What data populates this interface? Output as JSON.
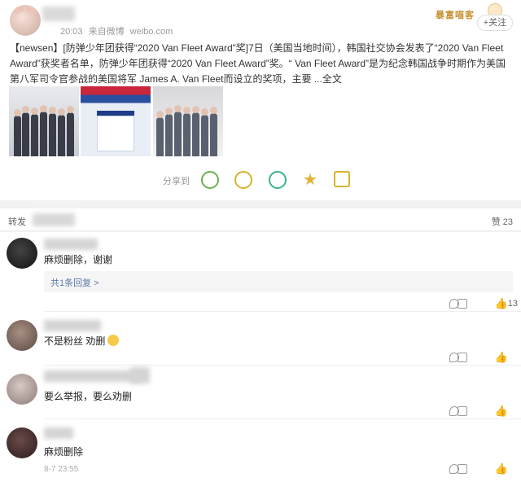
{
  "post": {
    "time": "20:03",
    "source": "来自微博",
    "site": "weibo.com",
    "brand_badge": "暴富喵客",
    "follow_label": "+关注",
    "text": "【newsen】[防弹少年团获得“2020 Van Fleet Award”奖]7日（美国当地时间），韩国社交协会发表了“2020 Van Fleet Award”获奖者名单，防弹少年团获得“2020 Van Fleet Award”奖。“ Van Fleet Award”是为纪念韩国战争时期作为美国第八军司令官参战的美国将军 James A. Van Fleet而设立的奖项，主要 ...全文",
    "share_label": "分享到",
    "images": [
      "group-photo-1",
      "award-announcement",
      "group-photo-2"
    ]
  },
  "forward_bar": {
    "forward_label": "转发",
    "like_label": "赞 23"
  },
  "comments": [
    {
      "text": "麻烦删除，谢谢",
      "replies": "共1条回复 >",
      "time": "",
      "likes": "13"
    },
    {
      "text": "不是粉丝 劝删",
      "replies": "",
      "time": "",
      "likes": ""
    },
    {
      "text": "要么举报，要么劝删",
      "replies": "",
      "time": "",
      "likes": ""
    },
    {
      "text": "麻烦删除",
      "replies": "",
      "time": "8-7 23:55",
      "likes": ""
    }
  ],
  "colors": {
    "link": "#5b7aa8",
    "accent": "#c7902f",
    "background": "#f2f2f2"
  }
}
